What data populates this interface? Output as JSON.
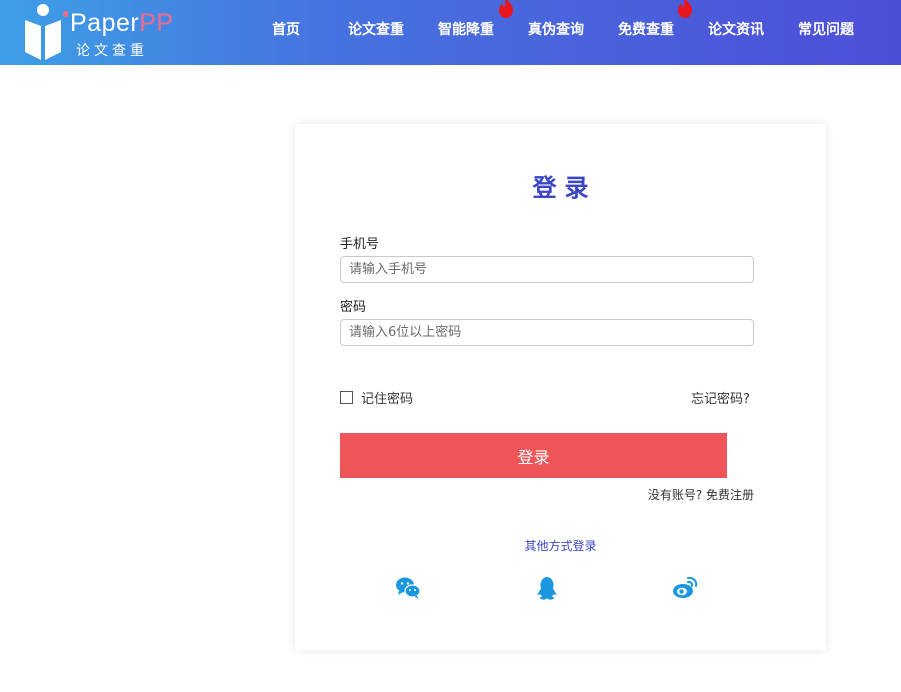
{
  "header": {
    "logo": {
      "word_main": "Paper",
      "word_accent": "PP",
      "subtitle": "论文查重"
    },
    "nav": [
      {
        "label": "首页",
        "hot": false
      },
      {
        "label": "论文查重",
        "hot": false
      },
      {
        "label": "智能降重",
        "hot": true
      },
      {
        "label": "真伪查询",
        "hot": false
      },
      {
        "label": "免费查重",
        "hot": true
      },
      {
        "label": "论文资讯",
        "hot": false
      },
      {
        "label": "常见问题",
        "hot": false
      }
    ]
  },
  "login": {
    "title": "登录",
    "phone": {
      "label": "手机号",
      "placeholder": "请输入手机号",
      "value": ""
    },
    "password": {
      "label": "密码",
      "placeholder": "请输入6位以上密码",
      "value": ""
    },
    "remember": {
      "label": "记住密码",
      "checked": false
    },
    "forgot_label": "忘记密码?",
    "submit_label": "登录",
    "register_label": "没有账号? 免费注册",
    "other_methods_label": "其他方式登录",
    "social": [
      {
        "icon": "wechat-icon",
        "color": "#1a97de"
      },
      {
        "icon": "qq-icon",
        "color": "#1a97de"
      },
      {
        "icon": "weibo-icon",
        "color": "#1a97de"
      }
    ]
  },
  "colors": {
    "header_gradient_start": "#3d9fe6",
    "header_gradient_end": "#4d4ed8",
    "accent_blue": "#3b45c7",
    "button_red": "#ee5558",
    "hot_badge": "#e8171e"
  }
}
